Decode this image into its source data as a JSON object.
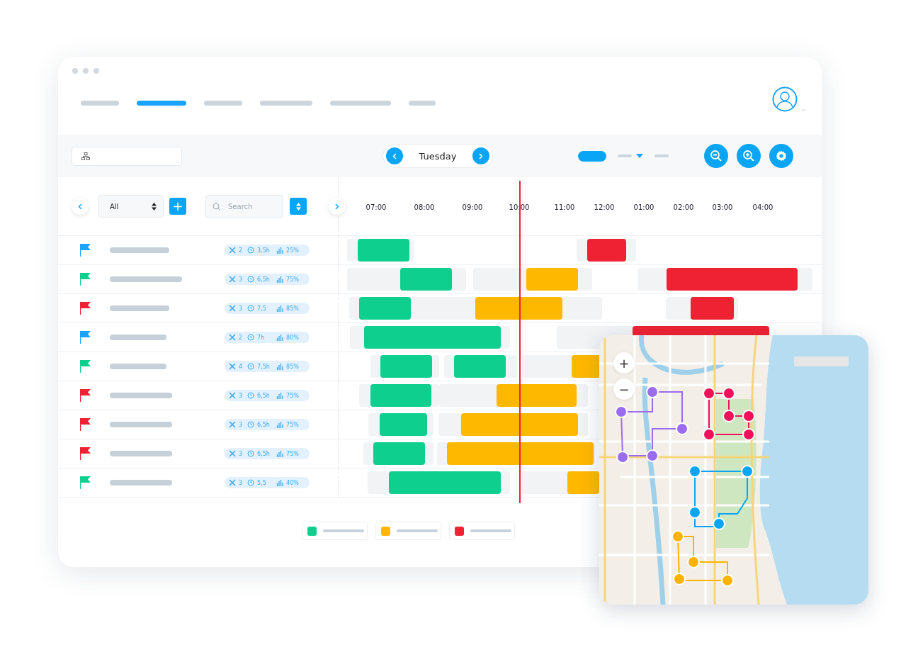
{
  "nav_tabs": [
    {
      "selected": false
    },
    {
      "selected": true
    },
    {
      "selected": false
    },
    {
      "selected": false
    },
    {
      "selected": false
    },
    {
      "selected": false
    }
  ],
  "day_picker": {
    "day": "Tuesday"
  },
  "view_switch": [
    {
      "selected": true
    },
    {
      "selected": false
    },
    {
      "selected": false
    }
  ],
  "filter": {
    "value": "All",
    "add_label": "+"
  },
  "search": {
    "placeholder": "Search"
  },
  "hours": [
    "07:00",
    "08:00",
    "09:00",
    "10:00",
    "11:00",
    "12:00",
    "01:00",
    "02:00",
    "03:00",
    "04:00"
  ],
  "rows": [
    {
      "color": "#1aa3ff",
      "tools": "2",
      "duration": "3,5h",
      "load": "25%",
      "bars": [
        {
          "color": "#0fcf8f"
        },
        {
          "color": "#ee2233"
        }
      ]
    },
    {
      "color": "#0fcf8f",
      "tools": "3",
      "duration": "6,5h",
      "load": "75%",
      "bars": [
        {
          "color": "#0fcf8f"
        },
        {
          "color": "#ffb800"
        },
        {
          "color": "#ee2233"
        }
      ]
    },
    {
      "color": "#ee2233",
      "tools": "3",
      "duration": "7,5",
      "load": "85%",
      "bars": [
        {
          "color": "#0fcf8f"
        },
        {
          "color": "#ffb800"
        },
        {
          "color": "#ee2233"
        }
      ]
    },
    {
      "color": "#1aa3ff",
      "tools": "2",
      "duration": "7h",
      "load": "80%",
      "bars": [
        {
          "color": "#0fcf8f"
        },
        {
          "color": "#ee2233"
        }
      ]
    },
    {
      "color": "#0fcf8f",
      "tools": "4",
      "duration": "7,5h",
      "load": "85%",
      "bars": [
        {
          "color": "#0fcf8f"
        },
        {
          "color": "#0fcf8f"
        },
        {
          "color": "#ffb800"
        }
      ]
    },
    {
      "color": "#ee2233",
      "tools": "3",
      "duration": "6,5h",
      "load": "75%",
      "bars": [
        {
          "color": "#0fcf8f"
        },
        {
          "color": "#ffb800"
        }
      ]
    },
    {
      "color": "#ee2233",
      "tools": "3",
      "duration": "6,5h",
      "load": "75%",
      "bars": [
        {
          "color": "#0fcf8f"
        },
        {
          "color": "#ffb800"
        }
      ]
    },
    {
      "color": "#ee2233",
      "tools": "3",
      "duration": "6,5h",
      "load": "75%",
      "bars": [
        {
          "color": "#0fcf8f"
        },
        {
          "color": "#ffb800"
        }
      ]
    },
    {
      "color": "#0fcf8f",
      "tools": "3",
      "duration": "5,5",
      "load": "40%",
      "bars": [
        {
          "color": "#0fcf8f"
        },
        {
          "color": "#ffb800"
        }
      ]
    }
  ],
  "legend": [
    {
      "color": "#0fcf8f"
    },
    {
      "color": "#ffb800"
    },
    {
      "color": "#ee2233"
    }
  ],
  "map": {
    "zoom_in": "+",
    "zoom_out": "−",
    "routes": [
      {
        "color": "#9b6cf0"
      },
      {
        "color": "#f0115a"
      },
      {
        "color": "#0aa6f5"
      },
      {
        "color": "#ffb300"
      }
    ]
  }
}
